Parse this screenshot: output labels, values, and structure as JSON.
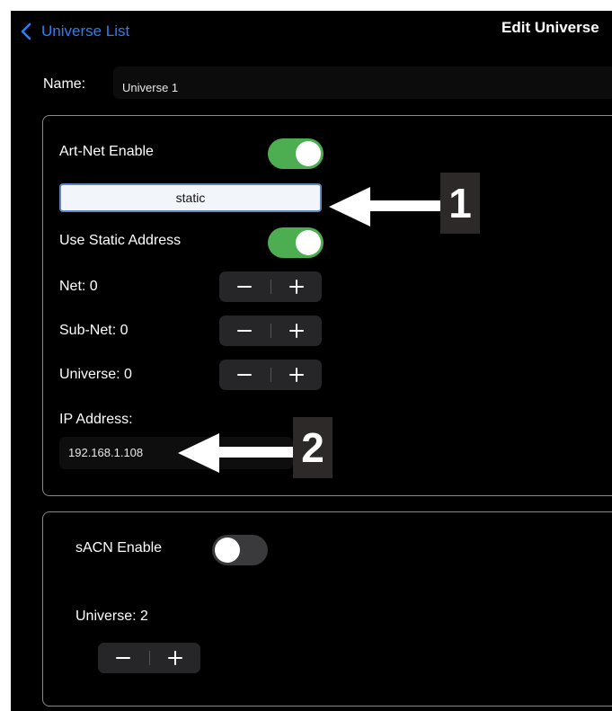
{
  "nav": {
    "back_label": "Universe List",
    "title": "Edit Universe"
  },
  "name": {
    "label": "Name:",
    "value": "Universe 1"
  },
  "artnet": {
    "enable_label": "Art-Net Enable",
    "enabled": true,
    "mode_value": "static",
    "static_label": "Use Static Address",
    "static_enabled": true,
    "net_label": "Net: 0",
    "subnet_label": "Sub-Net: 0",
    "universe_label": "Universe: 0",
    "ip_label": "IP Address:",
    "ip_value": "192.168.1.108"
  },
  "sacn": {
    "enable_label": "sACN Enable",
    "enabled": false,
    "universe_label": "Universe: 2"
  },
  "callouts": {
    "one": "1",
    "two": "2"
  },
  "colors": {
    "accent": "#2f7df6",
    "toggle_on": "#4cae51",
    "toggle_off": "#3a3a3c",
    "background": "#000000"
  },
  "icons": {
    "back": "chevron-left-icon",
    "minus": "minus-icon",
    "plus": "plus-icon",
    "arrow": "arrow-left-icon"
  }
}
